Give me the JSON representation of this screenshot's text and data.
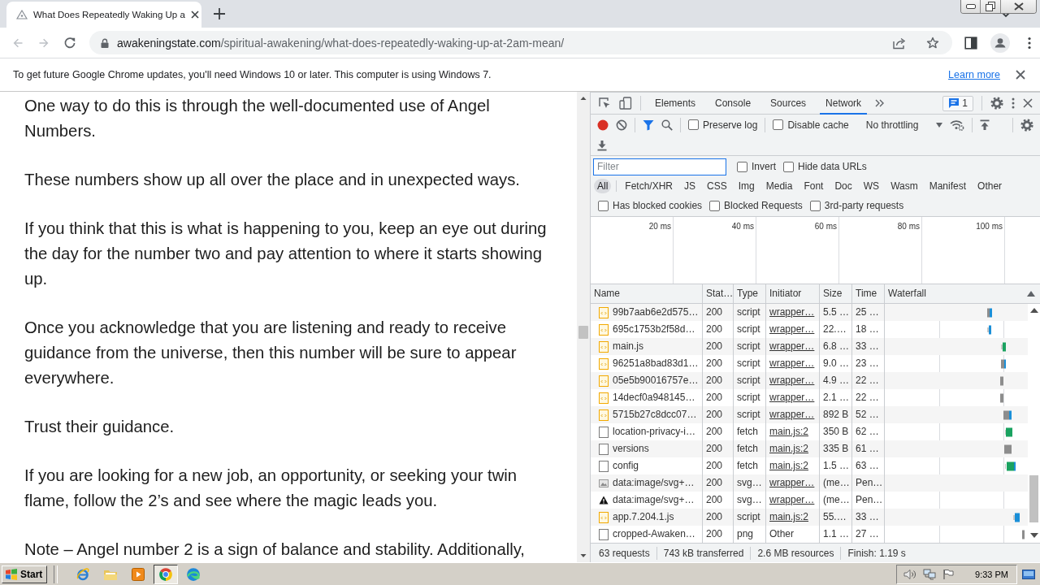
{
  "browser": {
    "tabs": [
      {
        "title": "What Does Repeatedly Waking Up a",
        "selected": true
      }
    ],
    "navigation": {
      "back_disabled": true,
      "forward_disabled": true
    },
    "address": {
      "host": "awakeningstate.com",
      "path": "/spiritual-awakening/what-does-repeatedly-waking-up-at-2am-mean/"
    },
    "infobar": {
      "message": "To get future Google Chrome updates, you'll need Windows 10 or later. This computer is using Windows 7.",
      "link": "Learn more"
    }
  },
  "article": {
    "paragraphs": [
      "One way to do this is through the well-documented use of Angel Numbers.",
      "These numbers show up all over the place and in unexpected ways.",
      "If you think that this is what is happening to you, keep an eye out during the day for the number two and pay attention to where it starts showing up.",
      "Once you acknowledge that you are listening and ready to receive guidance from the universe, then this number will be sure to appear everywhere.",
      "Trust their guidance.",
      "If you are looking for a new job, an opportunity, or seeking your twin flame, follow the 2’s and see where the magic leads you.",
      "Note – Angel number 2 is a sign of balance and stability. Additionally,"
    ]
  },
  "devtools": {
    "tabs": [
      {
        "label": "Elements",
        "selected": false
      },
      {
        "label": "Console",
        "selected": false
      },
      {
        "label": "Sources",
        "selected": false
      },
      {
        "label": "Network",
        "selected": true
      }
    ],
    "issues_count": "1",
    "toolbar": {
      "recording": true,
      "filter_open": true,
      "options": [
        {
          "label": "Preserve log",
          "checked": false
        },
        {
          "label": "Disable cache",
          "checked": false
        }
      ],
      "throttling": "No throttling"
    },
    "filter": {
      "placeholder": "Filter",
      "options": [
        {
          "label": "Invert",
          "checked": false
        },
        {
          "label": "Hide data URLs",
          "checked": false
        }
      ]
    },
    "types": [
      {
        "label": "All",
        "selected": true
      },
      {
        "label": "Fetch/XHR",
        "selected": false
      },
      {
        "label": "JS",
        "selected": false
      },
      {
        "label": "CSS",
        "selected": false
      },
      {
        "label": "Img",
        "selected": false
      },
      {
        "label": "Media",
        "selected": false
      },
      {
        "label": "Font",
        "selected": false
      },
      {
        "label": "Doc",
        "selected": false
      },
      {
        "label": "WS",
        "selected": false
      },
      {
        "label": "Wasm",
        "selected": false
      },
      {
        "label": "Manifest",
        "selected": false
      },
      {
        "label": "Other",
        "selected": false
      }
    ],
    "request_options": [
      {
        "label": "Has blocked cookies",
        "checked": false
      },
      {
        "label": "Blocked Requests",
        "checked": false
      },
      {
        "label": "3rd-party requests",
        "checked": false
      }
    ],
    "overview": {
      "ticks": [
        "20 ms",
        "40 ms",
        "60 ms",
        "80 ms",
        "100 ms"
      ]
    },
    "table": {
      "columns": [
        "Name",
        "Stat…",
        "Type",
        "Initiator",
        "Size",
        "Time",
        "Waterfall"
      ],
      "rows": [
        {
          "kind": "script",
          "name": "99b7aab6e2d575…",
          "status": "200",
          "type": "script",
          "initiator": "wrapper…",
          "initiator_link": true,
          "size": "5.5 …",
          "time": "25 …"
        },
        {
          "kind": "script",
          "name": "695c1753b2f58d…",
          "status": "200",
          "type": "script",
          "initiator": "wrapper…",
          "initiator_link": true,
          "size": "22.…",
          "time": "18 …"
        },
        {
          "kind": "script",
          "name": "main.js",
          "status": "200",
          "type": "script",
          "initiator": "wrapper…",
          "initiator_link": true,
          "size": "6.8 …",
          "time": "33 …"
        },
        {
          "kind": "script",
          "name": "96251a8bad83d1…",
          "status": "200",
          "type": "script",
          "initiator": "wrapper…",
          "initiator_link": true,
          "size": "9.0 …",
          "time": "23 …"
        },
        {
          "kind": "script",
          "name": "05e5b90016757e…",
          "status": "200",
          "type": "script",
          "initiator": "wrapper…",
          "initiator_link": true,
          "size": "4.9 …",
          "time": "22 …"
        },
        {
          "kind": "script",
          "name": "14decf0a948145…",
          "status": "200",
          "type": "script",
          "initiator": "wrapper…",
          "initiator_link": true,
          "size": "2.1 …",
          "time": "22 …"
        },
        {
          "kind": "script",
          "name": "5715b27c8dcc07…",
          "status": "200",
          "type": "script",
          "initiator": "wrapper…",
          "initiator_link": true,
          "size": "892 B",
          "time": "52 …"
        },
        {
          "kind": "plain",
          "name": "location-privacy-i…",
          "status": "200",
          "type": "fetch",
          "initiator": "main.js:2",
          "initiator_link": true,
          "size": "350 B",
          "time": "62 …"
        },
        {
          "kind": "plain",
          "name": "versions",
          "status": "200",
          "type": "fetch",
          "initiator": "main.js:2",
          "initiator_link": true,
          "size": "335 B",
          "time": "61 …"
        },
        {
          "kind": "plain",
          "name": "config",
          "status": "200",
          "type": "fetch",
          "initiator": "main.js:2",
          "initiator_link": true,
          "size": "1.5 …",
          "time": "63 …"
        },
        {
          "kind": "image",
          "name": "data:image/svg+…",
          "status": "200",
          "type": "svg…",
          "initiator": "wrapper…",
          "initiator_link": true,
          "size": "(me…",
          "time": "Pen…"
        },
        {
          "kind": "logo",
          "name": "data:image/svg+…",
          "status": "200",
          "type": "svg…",
          "initiator": "wrapper…",
          "initiator_link": true,
          "size": "(me…",
          "time": "Pen…"
        },
        {
          "kind": "script",
          "name": "app.7.204.1.js",
          "status": "200",
          "type": "script",
          "initiator": "main.js:2",
          "initiator_link": true,
          "size": "55.…",
          "time": "33 …"
        },
        {
          "kind": "plain",
          "name": "cropped-Awaken…",
          "status": "200",
          "type": "png",
          "initiator": "Other",
          "initiator_link": false,
          "size": "1.1 …",
          "time": "27 …"
        }
      ]
    },
    "summary": [
      "63 requests",
      "743 kB transferred",
      "2.6 MB resources",
      "Finish: 1.19 s"
    ]
  },
  "taskbar": {
    "start": "Start",
    "apps": [
      {
        "selected": false
      },
      {
        "selected": false
      },
      {
        "selected": false
      },
      {
        "selected": true
      },
      {
        "selected": false
      }
    ],
    "clock": "9:33 PM"
  }
}
